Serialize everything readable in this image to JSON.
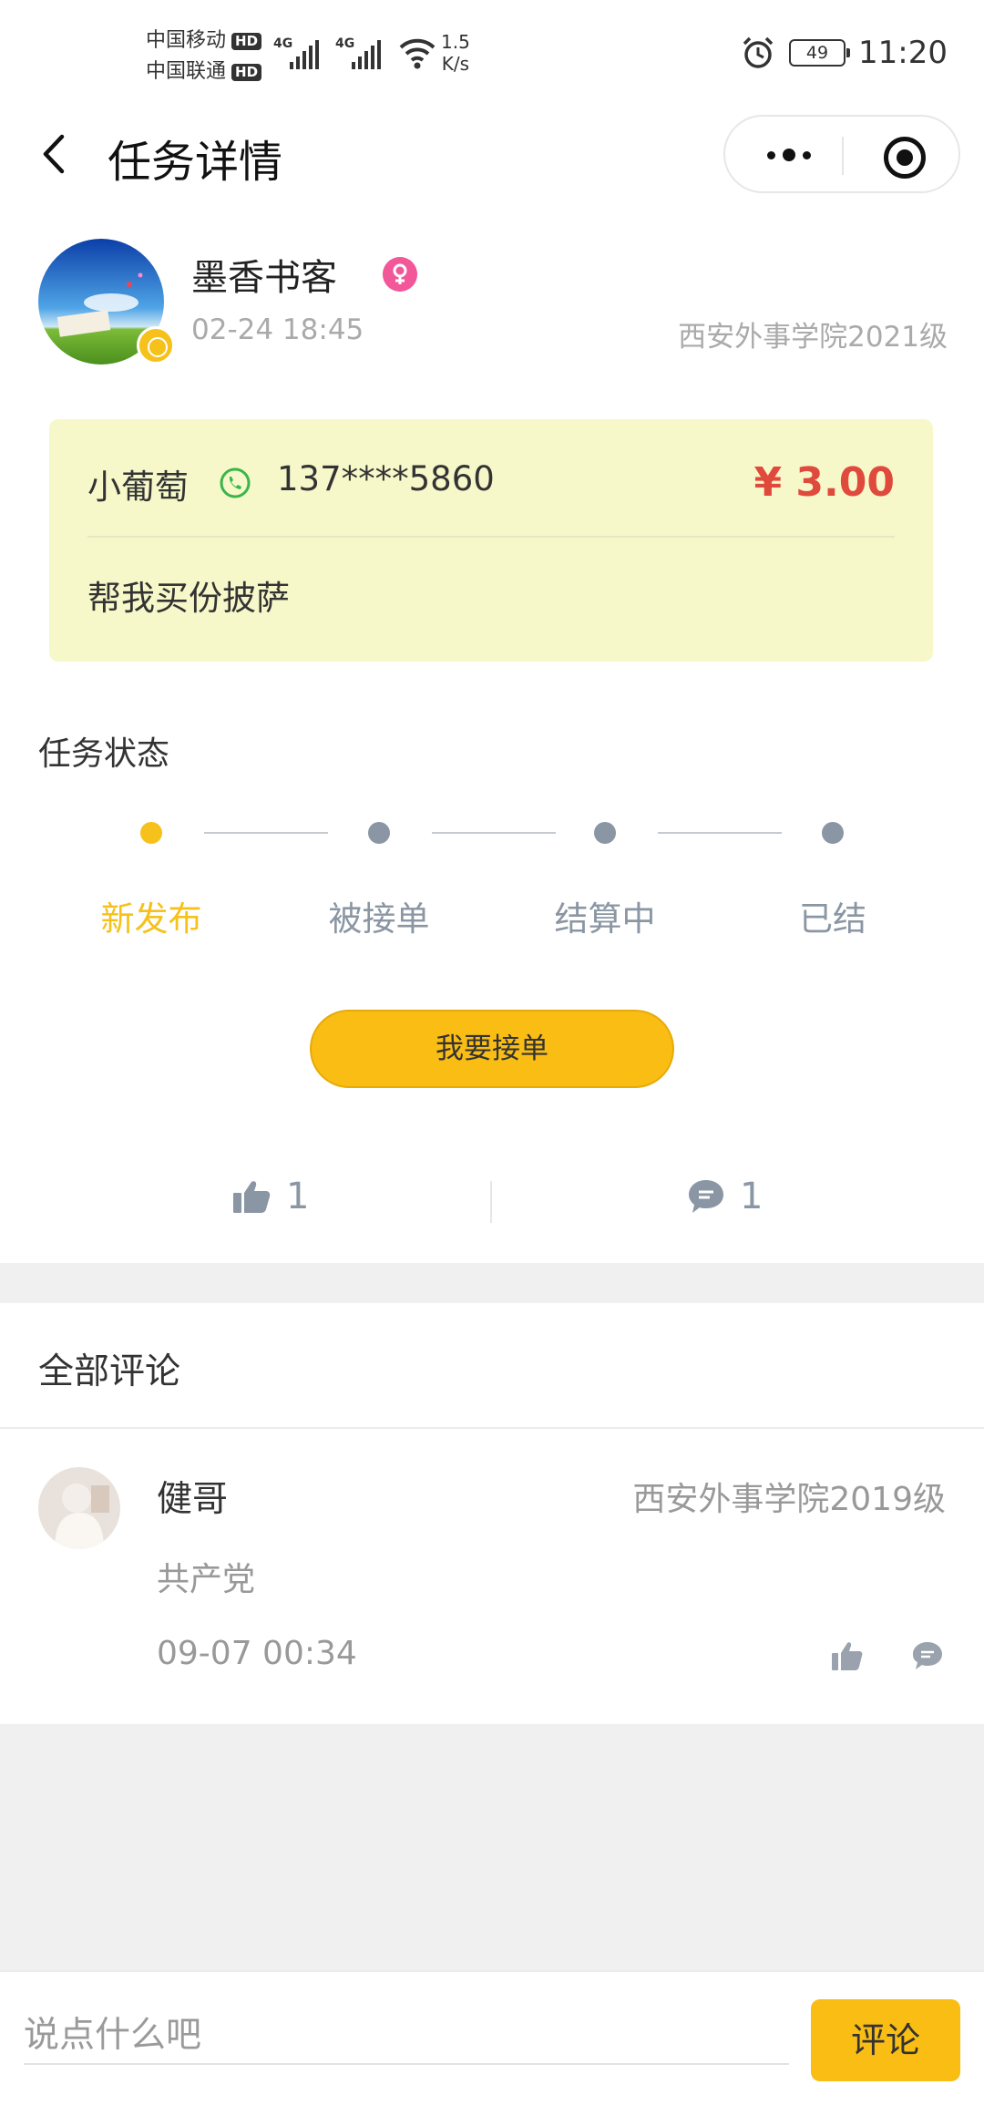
{
  "status_bar": {
    "carrier1": "中国移动",
    "carrier2": "中国联通",
    "hd": "HD",
    "net1": "4G",
    "net2": "4G",
    "speed_value": "1.5",
    "speed_unit": "K/s",
    "battery": "49",
    "time": "11:20"
  },
  "nav": {
    "title": "任务详情",
    "back_icon": "chevron-left-icon",
    "more_icon": "more-dots-icon",
    "close_icon": "target-circle-icon"
  },
  "publisher": {
    "name": "墨香书客",
    "time": "02-24 18:45",
    "school": "西安外事学院2021级",
    "gender_icon": "female-icon"
  },
  "task": {
    "contact_name": "小葡萄",
    "phone": "137****5860",
    "price": "¥ 3.00",
    "description": "帮我买份披萨"
  },
  "status": {
    "title": "任务状态",
    "steps": [
      {
        "label": "新发布",
        "active": true
      },
      {
        "label": "被接单",
        "active": false
      },
      {
        "label": "结算中",
        "active": false
      },
      {
        "label": "已结",
        "active": false
      }
    ]
  },
  "actions": {
    "accept_label": "我要接单",
    "like_count": "1",
    "comment_count": "1"
  },
  "comments": {
    "header": "全部评论",
    "items": [
      {
        "author": "健哥",
        "school": "西安外事学院2019级",
        "text": "共产党",
        "time": "09-07 00:34"
      }
    ]
  },
  "input": {
    "placeholder": "说点什么吧",
    "submit_label": "评论"
  },
  "colors": {
    "accent": "#f9bd14",
    "price": "#e04a3c",
    "card_bg": "#f6f8c9",
    "muted": "#8a96a3"
  }
}
